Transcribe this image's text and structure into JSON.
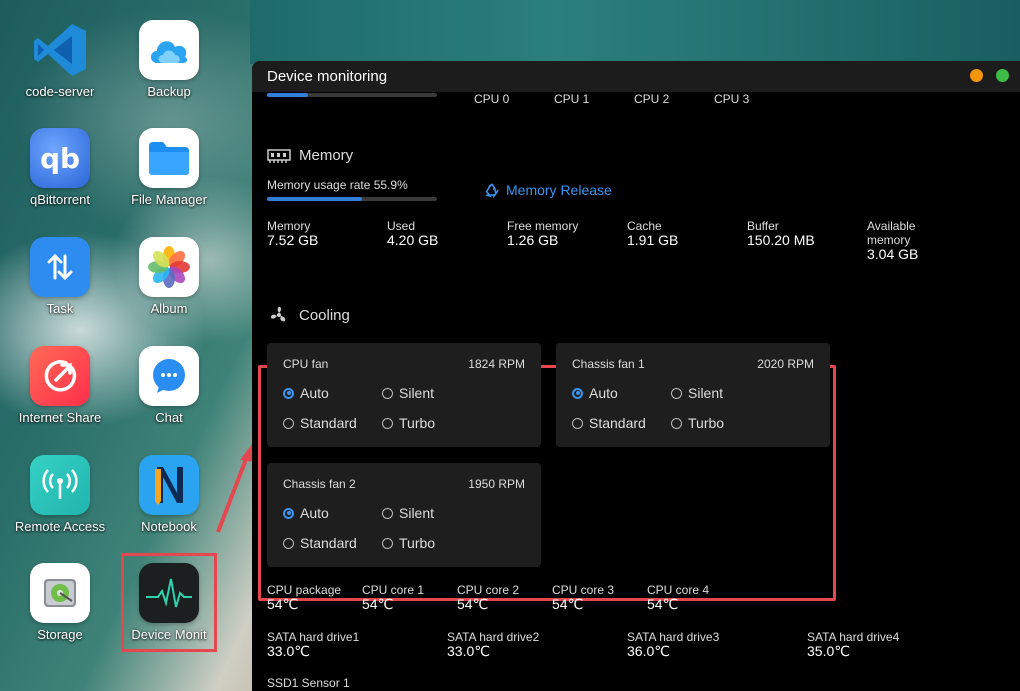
{
  "desktop": {
    "icons": [
      {
        "label": "code-server"
      },
      {
        "label": "Backup"
      },
      {
        "label": "qBittorrent"
      },
      {
        "label": "File Manager"
      },
      {
        "label": "Task"
      },
      {
        "label": "Album"
      },
      {
        "label": "Internet Share"
      },
      {
        "label": "Chat"
      },
      {
        "label": "Remote Access"
      },
      {
        "label": "Notebook"
      },
      {
        "label": "Storage"
      },
      {
        "label": "Device Monit"
      }
    ]
  },
  "window": {
    "title": "Device monitoring",
    "cpu": {
      "usage_fraction": 0.24,
      "cores": [
        "CPU 0",
        "CPU 1",
        "CPU 2",
        "CPU 3"
      ]
    },
    "memory": {
      "section_title": "Memory",
      "usage_label": "Memory usage rate 55.9%",
      "usage_fraction": 0.559,
      "release_label": "Memory Release",
      "stats": [
        {
          "label": "Memory",
          "value": "7.52 GB"
        },
        {
          "label": "Used",
          "value": "4.20 GB"
        },
        {
          "label": "Free memory",
          "value": "1.26 GB"
        },
        {
          "label": "Cache",
          "value": "1.91 GB"
        },
        {
          "label": "Buffer",
          "value": "150.20 MB"
        },
        {
          "label": "Available memory",
          "value": "3.04 GB"
        }
      ]
    },
    "cooling": {
      "section_title": "Cooling",
      "fans": [
        {
          "name": "CPU fan",
          "rpm": "1824 RPM",
          "selected": "Auto"
        },
        {
          "name": "Chassis fan 1",
          "rpm": "2020 RPM",
          "selected": "Auto"
        },
        {
          "name": "Chassis fan 2",
          "rpm": "1950 RPM",
          "selected": "Auto"
        }
      ],
      "modes": [
        "Auto",
        "Silent",
        "Standard",
        "Turbo"
      ]
    },
    "temperatures": {
      "cpu": [
        {
          "label": "CPU package",
          "value": "54℃"
        },
        {
          "label": "CPU core 1",
          "value": "54℃"
        },
        {
          "label": "CPU core 2",
          "value": "54℃"
        },
        {
          "label": "CPU core 3",
          "value": "54℃"
        },
        {
          "label": "CPU core 4",
          "value": "54℃"
        }
      ],
      "drives": [
        {
          "label": "SATA hard drive1",
          "value": "33.0℃"
        },
        {
          "label": "SATA hard drive2",
          "value": "33.0℃"
        },
        {
          "label": "SATA hard drive3",
          "value": "36.0℃"
        },
        {
          "label": "SATA hard drive4",
          "value": "35.0℃"
        }
      ],
      "ssd_label": "SSD1 Sensor 1"
    }
  },
  "colors": {
    "accent": "#3a95f0",
    "highlight": "#e4474f",
    "window_bg": "#000000",
    "card_bg": "#1e1e1e",
    "traffic_orange": "#f5950a",
    "traffic_green": "#3cbc46"
  }
}
